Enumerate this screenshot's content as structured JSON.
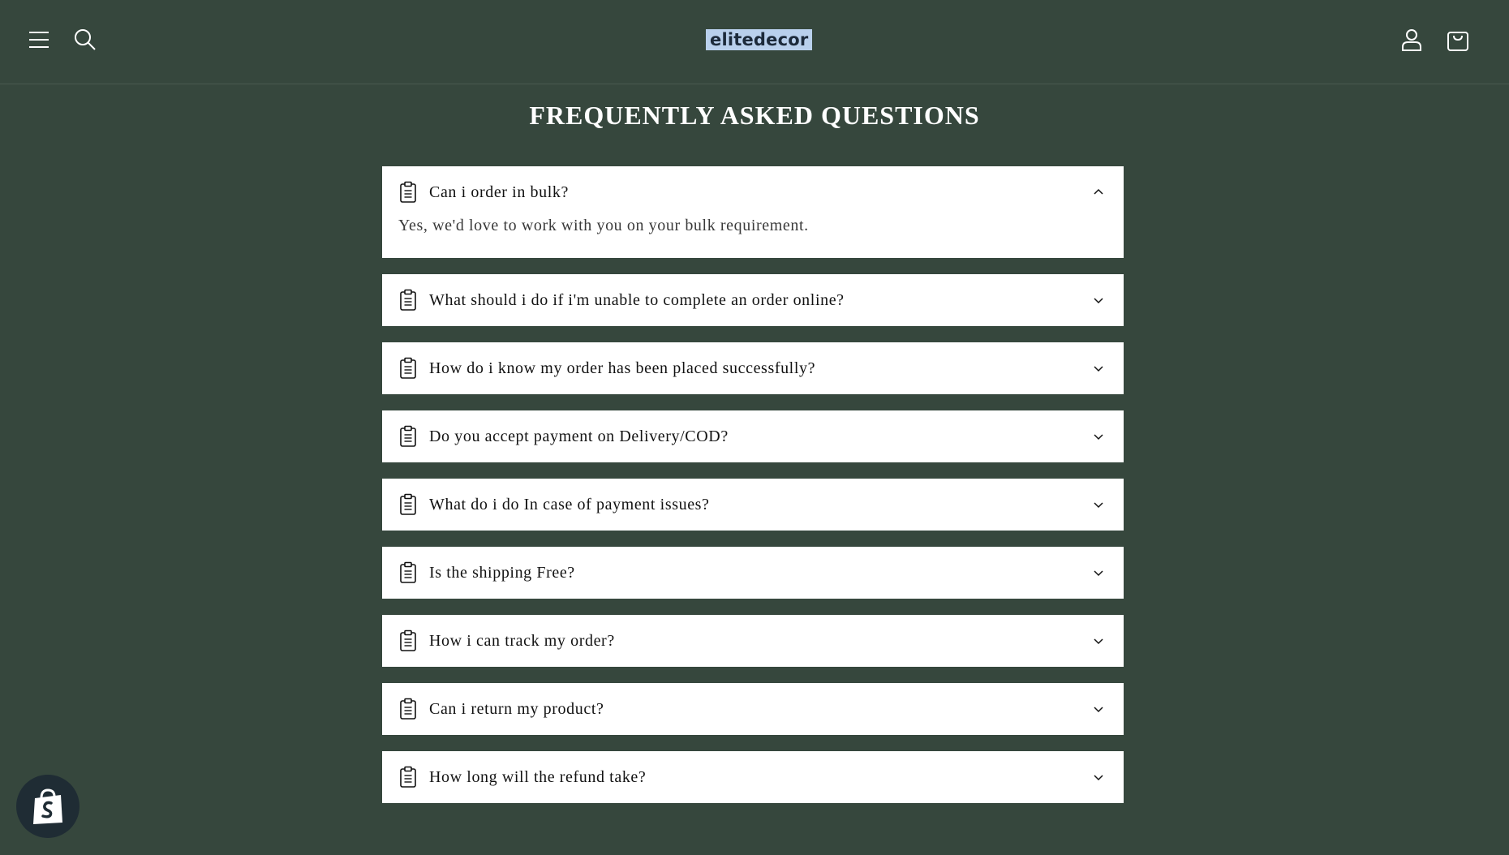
{
  "header": {
    "logo_text": "elitedecor",
    "menu_icon": "hamburger-menu-icon",
    "search_icon": "search-icon",
    "account_icon": "user-account-icon",
    "cart_icon": "shopping-bag-icon"
  },
  "page": {
    "title": "FREQUENTLY ASKED QUESTIONS"
  },
  "faq": {
    "items": [
      {
        "question": "Can i order in bulk?",
        "answer": "Yes, we'd love to work with you on your bulk requirement.",
        "expanded": true
      },
      {
        "question": "What should i do if i'm unable to complete an order online?",
        "expanded": false
      },
      {
        "question": "How do i know my order has been placed successfully?",
        "expanded": false
      },
      {
        "question": "Do you accept payment on Delivery/COD?",
        "expanded": false
      },
      {
        "question": "What do i do In case of payment issues?",
        "expanded": false
      },
      {
        "question": "Is the shipping Free?",
        "expanded": false
      },
      {
        "question": "How i can track my order?",
        "expanded": false
      },
      {
        "question": "Can i return my product?",
        "expanded": false
      },
      {
        "question": "How long will the refund take?",
        "expanded": false
      }
    ]
  },
  "colors": {
    "background": "#36473d",
    "card": "#ffffff",
    "logo_bg": "#b9d0ec",
    "badge_bg": "#1f2c34"
  },
  "badge": {
    "icon": "shopify-bag-icon"
  }
}
